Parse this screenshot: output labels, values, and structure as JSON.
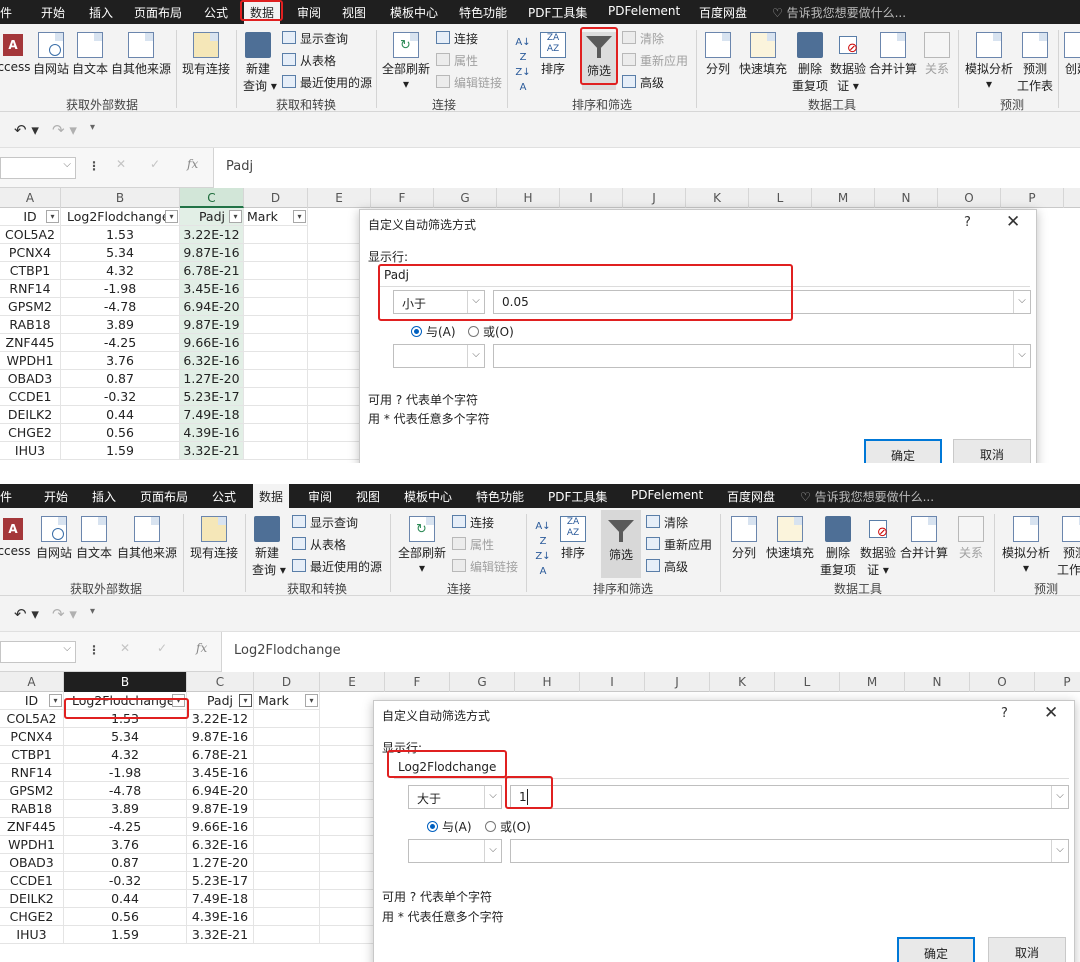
{
  "tabs": [
    {
      "label": "件"
    },
    {
      "label": "开始"
    },
    {
      "label": "插入"
    },
    {
      "label": "页面布局"
    },
    {
      "label": "公式"
    },
    {
      "label": "数据"
    },
    {
      "label": "审阅"
    },
    {
      "label": "视图"
    },
    {
      "label": "模板中心"
    },
    {
      "label": "特色功能"
    },
    {
      "label": "PDF工具集"
    },
    {
      "label": "PDFelement"
    },
    {
      "label": "百度网盘"
    }
  ],
  "tell_me": "告诉我您想要做什么...",
  "ribbon": {
    "access": "ccess",
    "web": "自网站",
    "text": "自文本",
    "other": "自其他来源",
    "existing": "现有连接",
    "new_query_1": "新建",
    "new_query_2": "查询 ▾",
    "show_query": "显示查询",
    "from_table": "从表格",
    "recent_sources": "最近使用的源",
    "refresh_all_1": "全部刷新",
    "refresh_all_2": "▾",
    "connections": "连接",
    "properties": "属性",
    "edit_links": "编辑链接",
    "sort": "排序",
    "filter": "筛选",
    "clear": "清除",
    "reapply": "重新应用",
    "advanced": "高级",
    "split": "分列",
    "flash_fill": "快速填充",
    "remove_dup_1": "删除",
    "remove_dup_2": "重复项",
    "validation_1": "数据验",
    "validation_2": "证 ▾",
    "consolidate": "合并计算",
    "relations": "关系",
    "whatif_1": "模拟分析",
    "whatif_2": "▾",
    "forecast_1": "预测",
    "forecast_2": "工作表",
    "create": "创建",
    "groups": {
      "external": "获取外部数据",
      "transform": "获取和转换",
      "connections": "连接",
      "sortfilter": "排序和筛选",
      "tools": "数据工具",
      "forecast": "预测"
    }
  },
  "qat": {
    "undo": "↶ ▾",
    "redo": "↷ ▾",
    "more": "▾"
  },
  "formula_bar": {
    "fx": "fx",
    "cancel": "✕",
    "enter": "✓",
    "dots": "⋮",
    "content_1": "Padj",
    "content_2": "Log2Flodchange"
  },
  "columns": [
    "A",
    "B",
    "C",
    "D",
    "E",
    "F",
    "G",
    "H",
    "I",
    "J",
    "K",
    "L",
    "M",
    "N",
    "O",
    "P"
  ],
  "header_row": {
    "id": "ID",
    "log2": "Log2Flodchange",
    "padj": "Padj",
    "mark": "Mark"
  },
  "rows": [
    {
      "id": "COL5A2",
      "log2": "1.53",
      "padj": "3.22E-12"
    },
    {
      "id": "PCNX4",
      "log2": "5.34",
      "padj": "9.87E-16"
    },
    {
      "id": "CTBP1",
      "log2": "4.32",
      "padj": "6.78E-21"
    },
    {
      "id": "RNF14",
      "log2": "-1.98",
      "padj": "3.45E-16"
    },
    {
      "id": "GPSM2",
      "log2": "-4.78",
      "padj": "6.94E-20"
    },
    {
      "id": "RAB18",
      "log2": "3.89",
      "padj": "9.87E-19"
    },
    {
      "id": "ZNF445",
      "log2": "-4.25",
      "padj": "9.66E-16"
    },
    {
      "id": "WPDH1",
      "log2": "3.76",
      "padj": "6.32E-16"
    },
    {
      "id": "OBAD3",
      "log2": "0.87",
      "padj": "1.27E-20"
    },
    {
      "id": "CCDE1",
      "log2": "-0.32",
      "padj": "5.23E-17"
    },
    {
      "id": "DEILK2",
      "log2": "0.44",
      "padj": "7.49E-18"
    },
    {
      "id": "CHGE2",
      "log2": "0.56",
      "padj": "4.39E-16"
    },
    {
      "id": "IHU3",
      "log2": "1.59",
      "padj": "3.32E-21"
    }
  ],
  "dialog": {
    "title": "自定义自动筛选方式",
    "help": "?",
    "close": "✕",
    "show_rows": "显示行:",
    "and": "与(A)",
    "or": "或(O)",
    "hint1": "可用 ? 代表单个字符",
    "hint2": "用 * 代表任意多个字符",
    "ok": "确定",
    "cancel": "取消",
    "panel1": {
      "field": "Padj",
      "operator": "小于",
      "value": "0.05"
    },
    "panel2": {
      "field": "Log2Flodchange",
      "operator": "大于",
      "value": "1"
    }
  },
  "colors": {
    "highlight": "#e02020",
    "excel_green": "#217346",
    "dark_tabbar": "#1f1f1f"
  }
}
